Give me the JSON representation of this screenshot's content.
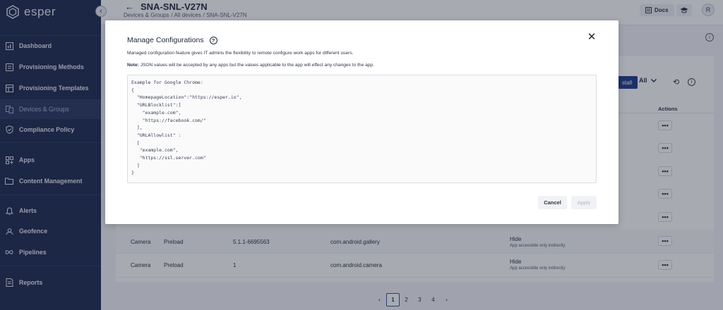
{
  "app": {
    "logo_text": "esper",
    "collapse_glyph": "‹"
  },
  "sidebar": {
    "items": [
      {
        "label": "Dashboard",
        "icon": "dashboard-icon"
      },
      {
        "label": "Provisioning Methods",
        "icon": "provisioning-methods-icon"
      },
      {
        "label": "Provisioning Templates",
        "icon": "provisioning-templates-icon"
      },
      {
        "label": "Devices & Groups",
        "icon": "devices-groups-icon",
        "active": true
      },
      {
        "label": "Compliance Policy",
        "icon": "compliance-shield-icon"
      },
      {
        "label": "Apps",
        "icon": "apps-icon"
      },
      {
        "label": "Content Management",
        "icon": "folder-icon"
      },
      {
        "label": "Alerts",
        "icon": "bell-icon"
      },
      {
        "label": "Geofence",
        "icon": "geofence-icon"
      },
      {
        "label": "Pipelines",
        "icon": "pipelines-icon"
      },
      {
        "label": "Reports",
        "icon": "reports-icon"
      }
    ]
  },
  "header": {
    "back_glyph": "←",
    "title": "SNA-SNL-V27N",
    "breadcrumb": [
      "Devices & Groups",
      "/ All devices",
      "/ SNA-SNL-V27N"
    ],
    "docs_label": "Docs",
    "avatar_initial": "R"
  },
  "toolbar": {
    "install_label": "stall",
    "filter_label": "All",
    "refresh_glyph": "⟲",
    "info_glyph": "i"
  },
  "table": {
    "actions_header": "Actions",
    "more_glyph": "•••",
    "rows": [
      {
        "app": "Camera",
        "type": "Preload",
        "version": "5.1.1-6695563",
        "package": "com.android.gallery",
        "visibility": "Hide",
        "visibility_note": "App accessible only indirectly"
      },
      {
        "app": "Camera",
        "type": "Preload",
        "version": "1",
        "package": "com.android.camera",
        "visibility": "Hide",
        "visibility_note": "App accessible only indirectly"
      }
    ]
  },
  "pagination": {
    "prev": "‹",
    "pages": [
      "1",
      "2",
      "3",
      "4"
    ],
    "next": "›",
    "current": "1"
  },
  "modal": {
    "title": "Manage Configurations",
    "help_glyph": "?",
    "close_glyph": "✕",
    "description": "Managed configuration feature gives IT admins the flexibility to remote configure work apps for different users.",
    "note_label": "Note:",
    "note_text": " JSON values will be accepted by any apps but the values applicable to the app will effect any changes to the app.",
    "json_placeholder": "Example for Google Chrome:\n{\n  \"HomepageLocation\":\"https://esper.io\",\n  \"URLBlocklist\":[\n    \"example.com\",\n    \"https://facebook.com/\"\n  ],\n  \"URLAllowlist\" :\n  [\n   \"example.com\",\n   \"https://ssl.server.com\"\n  ]\n}",
    "cancel_label": "Cancel",
    "apply_label": "Apply"
  },
  "colors": {
    "sidebar_bg": "#1e2a4f",
    "accent": "#1e3a8a"
  }
}
